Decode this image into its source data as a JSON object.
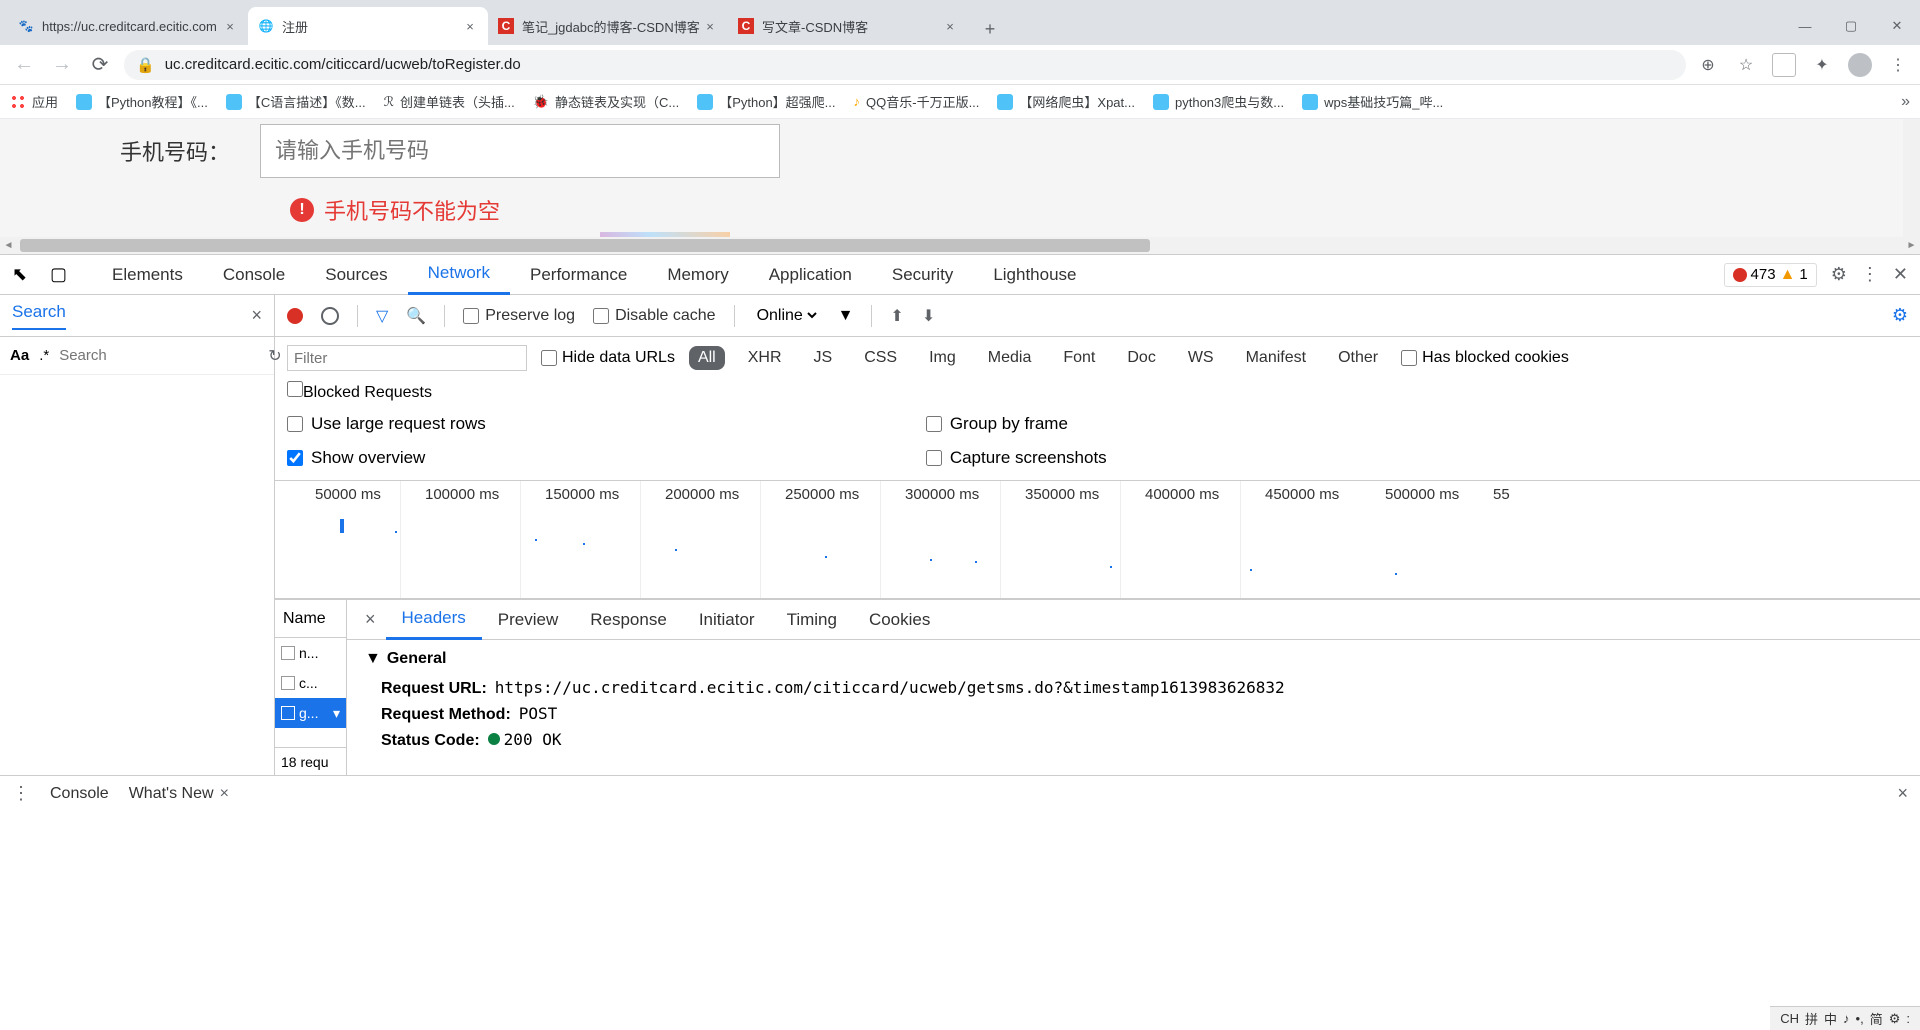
{
  "browser": {
    "tabs": [
      {
        "title": "https://uc.creditcard.ecitic.com",
        "favicon": "🐾"
      },
      {
        "title": "注册",
        "favicon": "🌐"
      },
      {
        "title": "笔记_jgdabc的博客-CSDN博客",
        "favicon": "C"
      },
      {
        "title": "写文章-CSDN博客",
        "favicon": "C"
      }
    ],
    "url": "uc.creditcard.ecitic.com/citiccard/ucweb/toRegister.do",
    "window": {
      "min": "—",
      "max": "▢",
      "close": "✕"
    }
  },
  "bookmarks": {
    "apps": "应用",
    "items": [
      "【Python教程】《...",
      "【C语言描述】《数...",
      "创建单链表（头插...",
      "静态链表及实现（C...",
      "【Python】超强爬...",
      "QQ音乐-千万正版...",
      "【网络爬虫】Xpat...",
      "python3爬虫与数...",
      "wps基础技巧篇_哔..."
    ]
  },
  "page": {
    "label": "手机号码：",
    "placeholder": "请输入手机号码",
    "error": "手机号码不能为空"
  },
  "devtools": {
    "tabs": [
      "Elements",
      "Console",
      "Sources",
      "Network",
      "Performance",
      "Memory",
      "Application",
      "Security",
      "Lighthouse"
    ],
    "active_tab": "Network",
    "errors": "473",
    "warnings": "1",
    "search": {
      "label": "Search",
      "placeholder": "Search",
      "aa": "Aa",
      "regex": ".*"
    },
    "toolbar": {
      "preserve": "Preserve log",
      "disable": "Disable cache",
      "online": "Online"
    },
    "filter": {
      "placeholder": "Filter",
      "hide": "Hide data URLs",
      "types": [
        "All",
        "XHR",
        "JS",
        "CSS",
        "Img",
        "Media",
        "Font",
        "Doc",
        "WS",
        "Manifest",
        "Other"
      ],
      "blocked_cookies": "Has blocked cookies",
      "blocked_req": "Blocked Requests"
    },
    "options": {
      "large_rows": "Use large request rows",
      "show_overview": "Show overview",
      "group_frame": "Group by frame",
      "capture": "Capture screenshots"
    },
    "timeline": [
      "50000 ms",
      "100000 ms",
      "150000 ms",
      "200000 ms",
      "250000 ms",
      "300000 ms",
      "350000 ms",
      "400000 ms",
      "450000 ms",
      "500000 ms",
      "55"
    ],
    "namelist": {
      "header": "Name",
      "items": [
        "n...",
        "c...",
        "g..."
      ],
      "footer": "18 requ"
    },
    "subtabs": [
      "Headers",
      "Preview",
      "Response",
      "Initiator",
      "Timing",
      "Cookies"
    ],
    "headers": {
      "section": "General",
      "url_label": "Request URL:",
      "url_value": "https://uc.creditcard.ecitic.com/citiccard/ucweb/getsms.do?&timestamp1613983626832",
      "method_label": "Request Method:",
      "method_value": "POST",
      "status_label": "Status Code:",
      "status_value": "200  OK"
    },
    "drawer": {
      "console": "Console",
      "whatsnew": "What's New"
    }
  },
  "ime": [
    "CH",
    "拼",
    "中",
    "♪",
    "•,",
    "简",
    "⚙",
    ":"
  ]
}
